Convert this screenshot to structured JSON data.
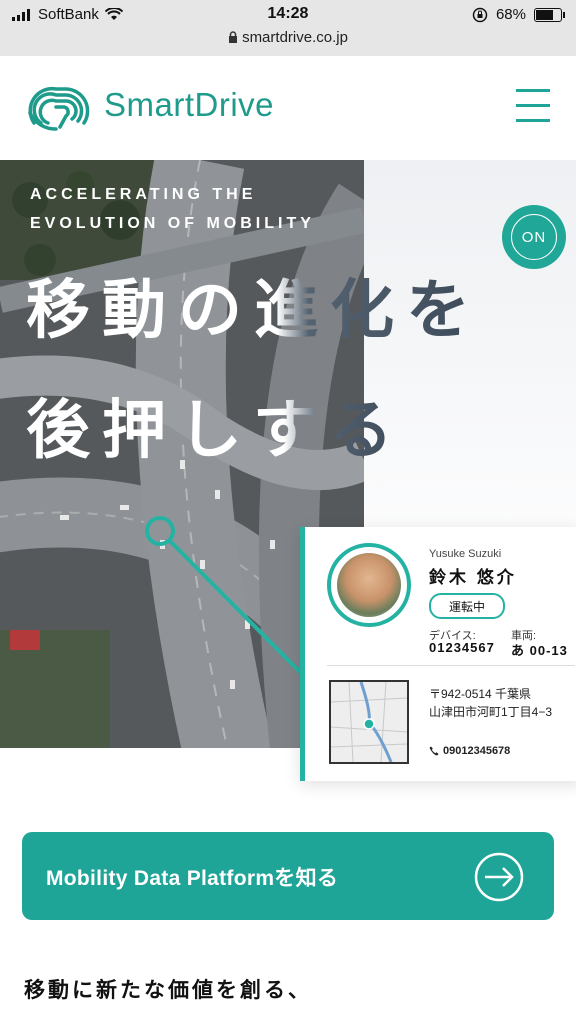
{
  "status_bar": {
    "carrier": "SoftBank",
    "time": "14:28",
    "battery": "68%",
    "url": "smartdrive.co.jp"
  },
  "header": {
    "logo_text": "SmartDrive",
    "brand_color": "#1f9b8c"
  },
  "hero": {
    "tagline_line1": "ACCELERATING THE",
    "tagline_line2": "EVOLUTION OF MOBILITY",
    "headline_line1": "移動の進化を",
    "headline_line2": "後押しする",
    "on_badge": "ON"
  },
  "driver_card": {
    "name_roman": "Yusuke Suzuki",
    "name_jp": "鈴木 悠介",
    "status": "運転中",
    "device_label": "デバイス:",
    "device_value": "01234567",
    "vehicle_label": "車両:",
    "vehicle_value": "あ 00-13",
    "address_line1": "〒942-0514 千葉県",
    "address_line2": "山津田市河町1丁目4−3",
    "phone": "09012345678",
    "accent_color": "#24b3a3"
  },
  "cta": {
    "label": "Mobility Data Platformを知る"
  },
  "section": {
    "heading": "移動に新たな価値を創る、"
  }
}
